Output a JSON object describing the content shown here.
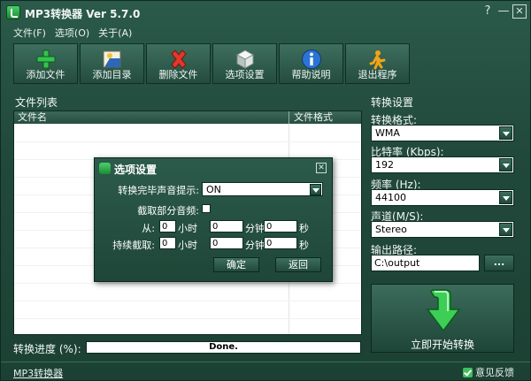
{
  "window": {
    "title": "MP3转换器 Ver 5.7.0",
    "help": "?",
    "minimize": "—",
    "close": "✕"
  },
  "menu": [
    "文件(F)",
    "选项(O)",
    "关于(A)"
  ],
  "toolbar": [
    {
      "label": "添加文件",
      "icon": "add-file-icon"
    },
    {
      "label": "添加目录",
      "icon": "add-folder-icon"
    },
    {
      "label": "删除文件",
      "icon": "delete-icon"
    },
    {
      "label": "选项设置",
      "icon": "settings-icon"
    },
    {
      "label": "帮助说明",
      "icon": "info-icon"
    },
    {
      "label": "退出程序",
      "icon": "exit-icon"
    }
  ],
  "file_list": {
    "heading": "文件列表",
    "col_name": "文件名",
    "col_format": "文件格式"
  },
  "settings": {
    "heading": "转换设置",
    "format_label": "转换格式:",
    "format_value": "WMA",
    "bitrate_label": "比特率 (Kbps):",
    "bitrate_value": "192",
    "freq_label": "频率 (Hz):",
    "freq_value": "44100",
    "channel_label": "声道(M/S):",
    "channel_value": "Stereo",
    "output_label": "输出路径:",
    "output_value": "C:\\output",
    "browse_label": "...",
    "start_label": "立即开始转换"
  },
  "progress": {
    "label": "转换进度 (%):",
    "text": "Done.",
    "value": 1
  },
  "status": {
    "link": "MP3转换器",
    "feedback": "意见反馈"
  },
  "dialog": {
    "title": "选项设置",
    "sound_label": "转换完毕声音提示:",
    "sound_value": "ON",
    "partial_label": "截取部分音频:",
    "from_label": "从:",
    "duration_label": "持续截取:",
    "from_h": "0",
    "from_m": "0",
    "from_s": "0",
    "dur_h": "0",
    "dur_m": "0",
    "dur_s": "0",
    "unit_h": "小时",
    "unit_m": "分钟",
    "unit_s": "秒",
    "ok_label": "确定",
    "back_label": "返回"
  },
  "colors": {
    "accent_green": "#2fb84a",
    "window_bg": "#21493b"
  }
}
